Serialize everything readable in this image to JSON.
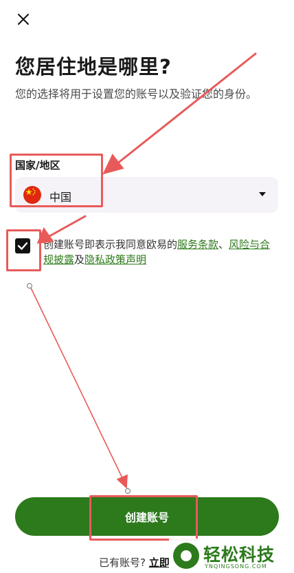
{
  "page": {
    "title": "您居住地是哪里?",
    "subtitle": "您的选择将用于设置您的账号以及验证您的身份。"
  },
  "form": {
    "country_label": "国家/地区",
    "country_value": "中国",
    "country_flag": "china-flag",
    "agree_checked": true,
    "terms_prefix": "创建账号即表示我同意欧易的",
    "terms_link": "服务条款",
    "separator": "、",
    "risk_link": "风险与合规披露",
    "and_text": "及",
    "privacy_link": "隐私政策声明"
  },
  "actions": {
    "create_button": "创建账号",
    "have_account": "已有账号?",
    "login_link": "立即"
  },
  "watermark": {
    "title": "轻松科技",
    "subtitle": "YNQINGSONG.COM"
  },
  "colors": {
    "accent": "#2c7a1c",
    "annotation": "#e85a5a",
    "select_bg": "#f5f3f7"
  }
}
